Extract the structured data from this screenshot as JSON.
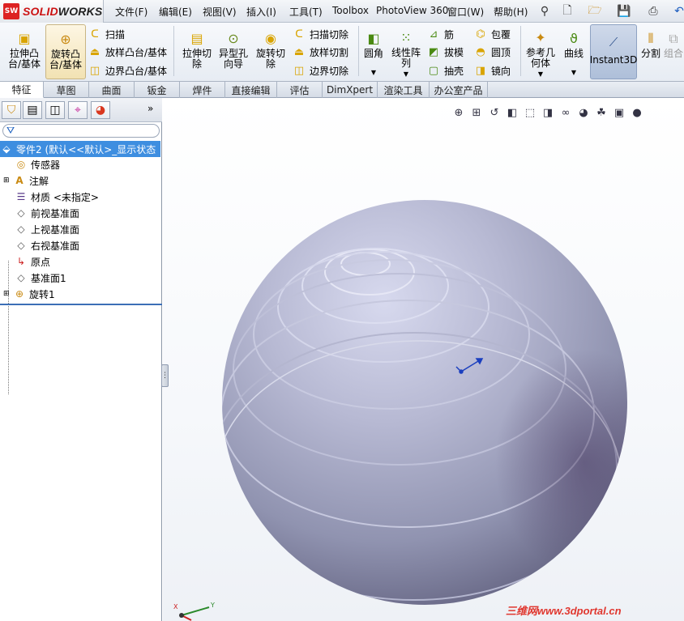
{
  "app": {
    "logo_text": "SOLIDWORKS"
  },
  "menu": [
    "文件(F)",
    "编辑(E)",
    "视图(V)",
    "插入(I)",
    "工具(T)",
    "Toolbox",
    "PhotoView 360",
    "窗口(W)",
    "帮助(H)"
  ],
  "ribbon": {
    "extrude_boss": "拉伸凸\n台/基体",
    "revolve_boss": "旋转凸\n台/基体",
    "sweep": "扫描",
    "loft_boss": "放样凸台/基体",
    "boundary_boss": "边界凸台/基体",
    "extrude_cut": "拉伸切\n除",
    "hole_wizard": "异型孔\n向导",
    "revolve_cut": "旋转切\n除",
    "swept_cut": "扫描切除",
    "lofted_cut": "放样切割",
    "boundary_cut": "边界切除",
    "fillet": "圆角",
    "linear_pattern": "线性阵\n列",
    "rib": "筋",
    "draft": "拔模",
    "shell": "抽壳",
    "wrap": "包覆",
    "dome": "圆顶",
    "mirror": "镜向",
    "reference_geometry": "参考几\n何体",
    "curves": "曲线",
    "instant3d": "Instant3D",
    "split": "分割",
    "combine": "组合"
  },
  "tabs": [
    "特征",
    "草图",
    "曲面",
    "钣金",
    "焊件",
    "直接编辑",
    "评估",
    "DimXpert",
    "渲染工具",
    "办公室产品"
  ],
  "active_tab": "特征",
  "tree": {
    "root": "零件2 (默认<<默认>_显示状态",
    "items": [
      {
        "label": "传感器",
        "icon": "sensor-icon"
      },
      {
        "label": "注解",
        "icon": "annotation-icon"
      },
      {
        "label": "材质 <未指定>",
        "icon": "material-icon"
      },
      {
        "label": "前视基准面",
        "icon": "plane-icon"
      },
      {
        "label": "上视基准面",
        "icon": "plane-icon"
      },
      {
        "label": "右视基准面",
        "icon": "plane-icon"
      },
      {
        "label": "原点",
        "icon": "origin-icon"
      },
      {
        "label": "基准面1",
        "icon": "plane-icon"
      },
      {
        "label": "旋转1",
        "icon": "revolve-icon"
      }
    ]
  },
  "watermark": "三维网www.3dportal.cn",
  "triad": {
    "x": "X",
    "y": "Y"
  },
  "colors": {
    "accent": "#3e8ee0",
    "sphere": "#a9abcb",
    "watermark": "#e0372f"
  }
}
